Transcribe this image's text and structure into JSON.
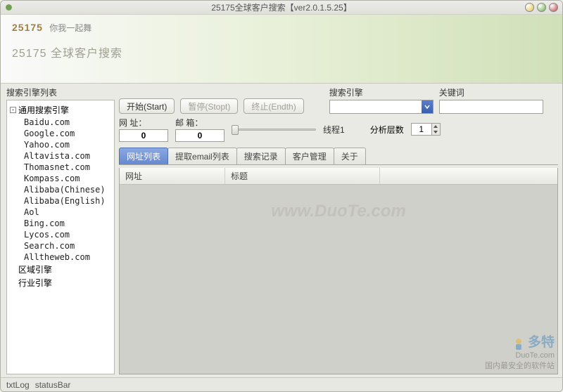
{
  "window": {
    "title": "25175全球客户搜索【ver2.0.1.5.25】"
  },
  "banner": {
    "logo": "25175",
    "slogan": "你我一起舞",
    "title": "25175 全球客户搜索"
  },
  "sidebar": {
    "title": "搜索引擎列表",
    "root": "通用搜索引擎",
    "items": [
      "Baidu.com",
      "Google.com",
      "Yahoo.com",
      "Altavista.com",
      "Thomasnet.com",
      "Kompass.com",
      "Alibaba(Chinese)",
      "Alibaba(English)",
      "Aol",
      "Bing.com",
      "Lycos.com",
      "Search.com",
      "Alltheweb.com"
    ],
    "other_roots": [
      "区域引擎",
      "行业引擎"
    ]
  },
  "controls": {
    "start": "开始(Start)",
    "pause": "暂停(Stopt)",
    "end": "终止(Endth)",
    "engine_label": "搜索引擎",
    "keyword_label": "关键词",
    "keyword_value": "",
    "url_label": "网 址：",
    "mail_label": "邮 箱：",
    "url_count": "0",
    "mail_count": "0",
    "thread_label": "线程1",
    "depth_label": "分析层数",
    "depth_value": "1"
  },
  "tabs": [
    "网址列表",
    "提取email列表",
    "搜索记录",
    "客户管理",
    "关于"
  ],
  "list": {
    "col1": "网址",
    "col2": "标题"
  },
  "watermark": "www.DuoTe.com",
  "statusbar": {
    "txt": "txtLog",
    "bar": "statusBar"
  },
  "footer": {
    "big": "多特",
    "url": "DuoTe.com",
    "sub": "国内最安全的软件站"
  }
}
